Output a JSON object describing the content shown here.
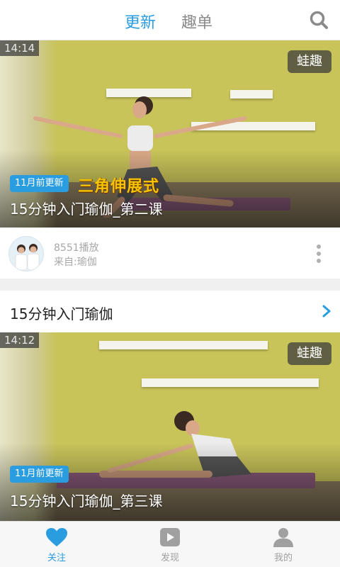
{
  "header": {
    "tabs": [
      {
        "label": "更新",
        "active": true
      },
      {
        "label": "趣单",
        "active": false
      }
    ],
    "search_icon": "search-icon"
  },
  "feed": [
    {
      "duration": "14:14",
      "brand": "蛙趣",
      "badge": "11月前更新",
      "caption_art": "三角伸展式",
      "title": "15分钟入门瑜伽_第二课",
      "plays": "8551播放",
      "source": "来自:瑜伽"
    }
  ],
  "section": {
    "title": "15分钟入门瑜伽",
    "chevron_icon": "chevron-right-icon"
  },
  "feed2": [
    {
      "duration": "14:12",
      "brand": "蛙趣",
      "badge": "11月前更新",
      "title": "15分钟入门瑜伽_第三课"
    }
  ],
  "bottom_nav": [
    {
      "label": "关注",
      "icon": "heart-icon",
      "active": true
    },
    {
      "label": "发现",
      "icon": "play-icon",
      "active": false
    },
    {
      "label": "我的",
      "icon": "user-icon",
      "active": false
    }
  ],
  "colors": {
    "accent": "#2a9de0",
    "inactive": "#a0a0a0",
    "background": "#f0f0f0"
  }
}
